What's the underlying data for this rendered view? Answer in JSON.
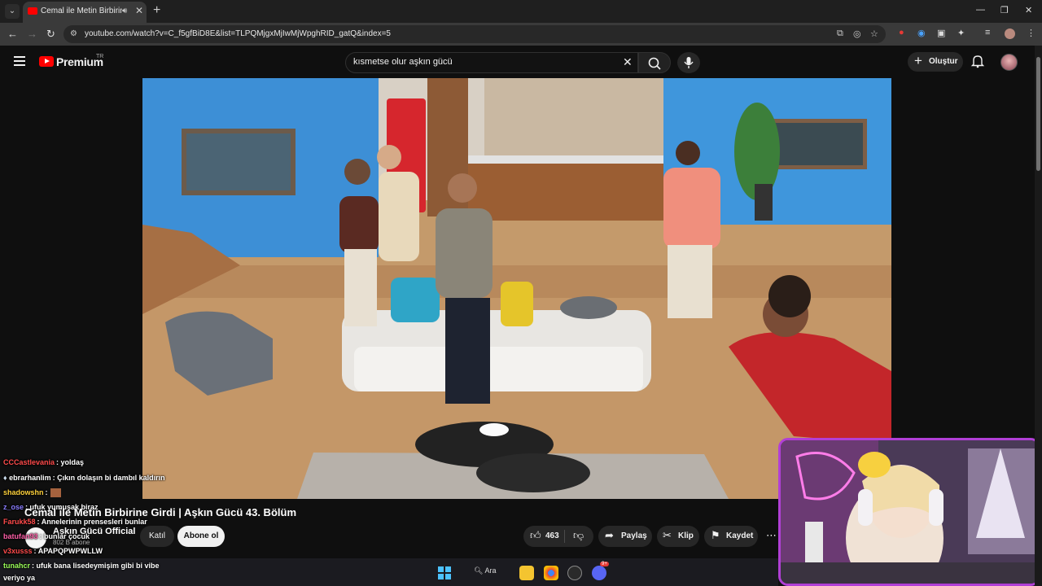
{
  "browser": {
    "tab": {
      "title": "Cemal ile Metin Birbirine Girdi",
      "audio_icon": "speaker-icon"
    },
    "address": {
      "url": "youtube.com/watch?v=C_f5gfBiD8E&list=TLPQMjgxMjIwMjWpghRID_gatQ&index=5"
    }
  },
  "header": {
    "logo_text": "Premium",
    "region": "TR",
    "search_value": "kısmetse olur aşkın gücü",
    "create_label": "Oluştur"
  },
  "video": {
    "title": "Cemal ile Metin Birbirine Girdi | Aşkın Gücü 43. Bölüm",
    "channel": "Aşkın Gücü Official",
    "subscribers": "802 B abone",
    "join_label": "Katıl",
    "subscribe_label": "Abone ol",
    "likes": "463",
    "share_label": "Paylaş",
    "clip_label": "Klip",
    "save_label": "Kaydet"
  },
  "chat": [
    {
      "user": "CCCastlevania",
      "text": ": yoldaş",
      "color": "#ff4b4b"
    },
    {
      "user": "ebrarhanlim",
      "text": ": Çıkın dolaşın bi dambıl kaldırın",
      "color": "#ffffff"
    },
    {
      "user": "shadowshn",
      "text": ":",
      "color": "#ffd23c"
    },
    {
      "user": "z_ose",
      "text": ": ufuk yumuşak biraz",
      "color": "#8a7dff"
    },
    {
      "user": "Farukk58",
      "text": ": Annelerinin prensesleri bunlar",
      "color": "#ff4b4b"
    },
    {
      "user": "batufan93",
      "text": ": bunlar çocuk",
      "color": "#ff5fa8"
    },
    {
      "user": "v3xusss",
      "text": ": APAPQPWPWLLW",
      "color": "#ff4b4b"
    },
    {
      "user": "tunahcr",
      "text": ": ufuk bana lisedeymişim gibi bi vibe",
      "color": "#9cff5a"
    },
    {
      "user": "",
      "text": "veriyo ya",
      "color": "#ffffff"
    }
  ],
  "taskbar": {
    "search_label": "Ara",
    "discord_badge": "9+"
  },
  "colors": {
    "accent": "#ff0000",
    "webcam_border": "#b13fd6",
    "background": "#0f0f0f"
  }
}
